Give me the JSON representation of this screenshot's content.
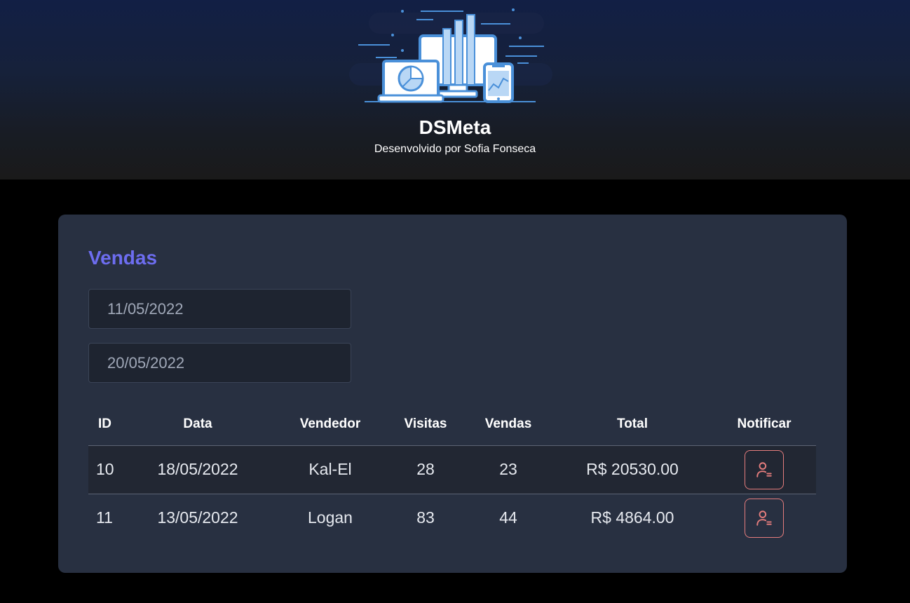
{
  "header": {
    "title": "DSMeta",
    "subtitle": "Desenvolvido por Sofia Fonseca",
    "logo_icon": "dashboard-illustration-icon"
  },
  "sales": {
    "title": "Vendas",
    "min_date": "11/05/2022",
    "max_date": "20/05/2022",
    "columns": [
      "ID",
      "Data",
      "Vendedor",
      "Visitas",
      "Vendas",
      "Total",
      "Notificar"
    ],
    "rows": [
      {
        "id": "10",
        "date": "18/05/2022",
        "seller": "Kal-El",
        "visits": "28",
        "deals": "23",
        "total": "R$ 20530.00"
      },
      {
        "id": "11",
        "date": "13/05/2022",
        "seller": "Logan",
        "visits": "83",
        "deals": "44",
        "total": "R$ 4864.00"
      }
    ],
    "notify_icon": "notify-user-icon"
  },
  "colors": {
    "accent": "#6d6df0",
    "card": "#283041",
    "notify": "#e57d7d"
  }
}
